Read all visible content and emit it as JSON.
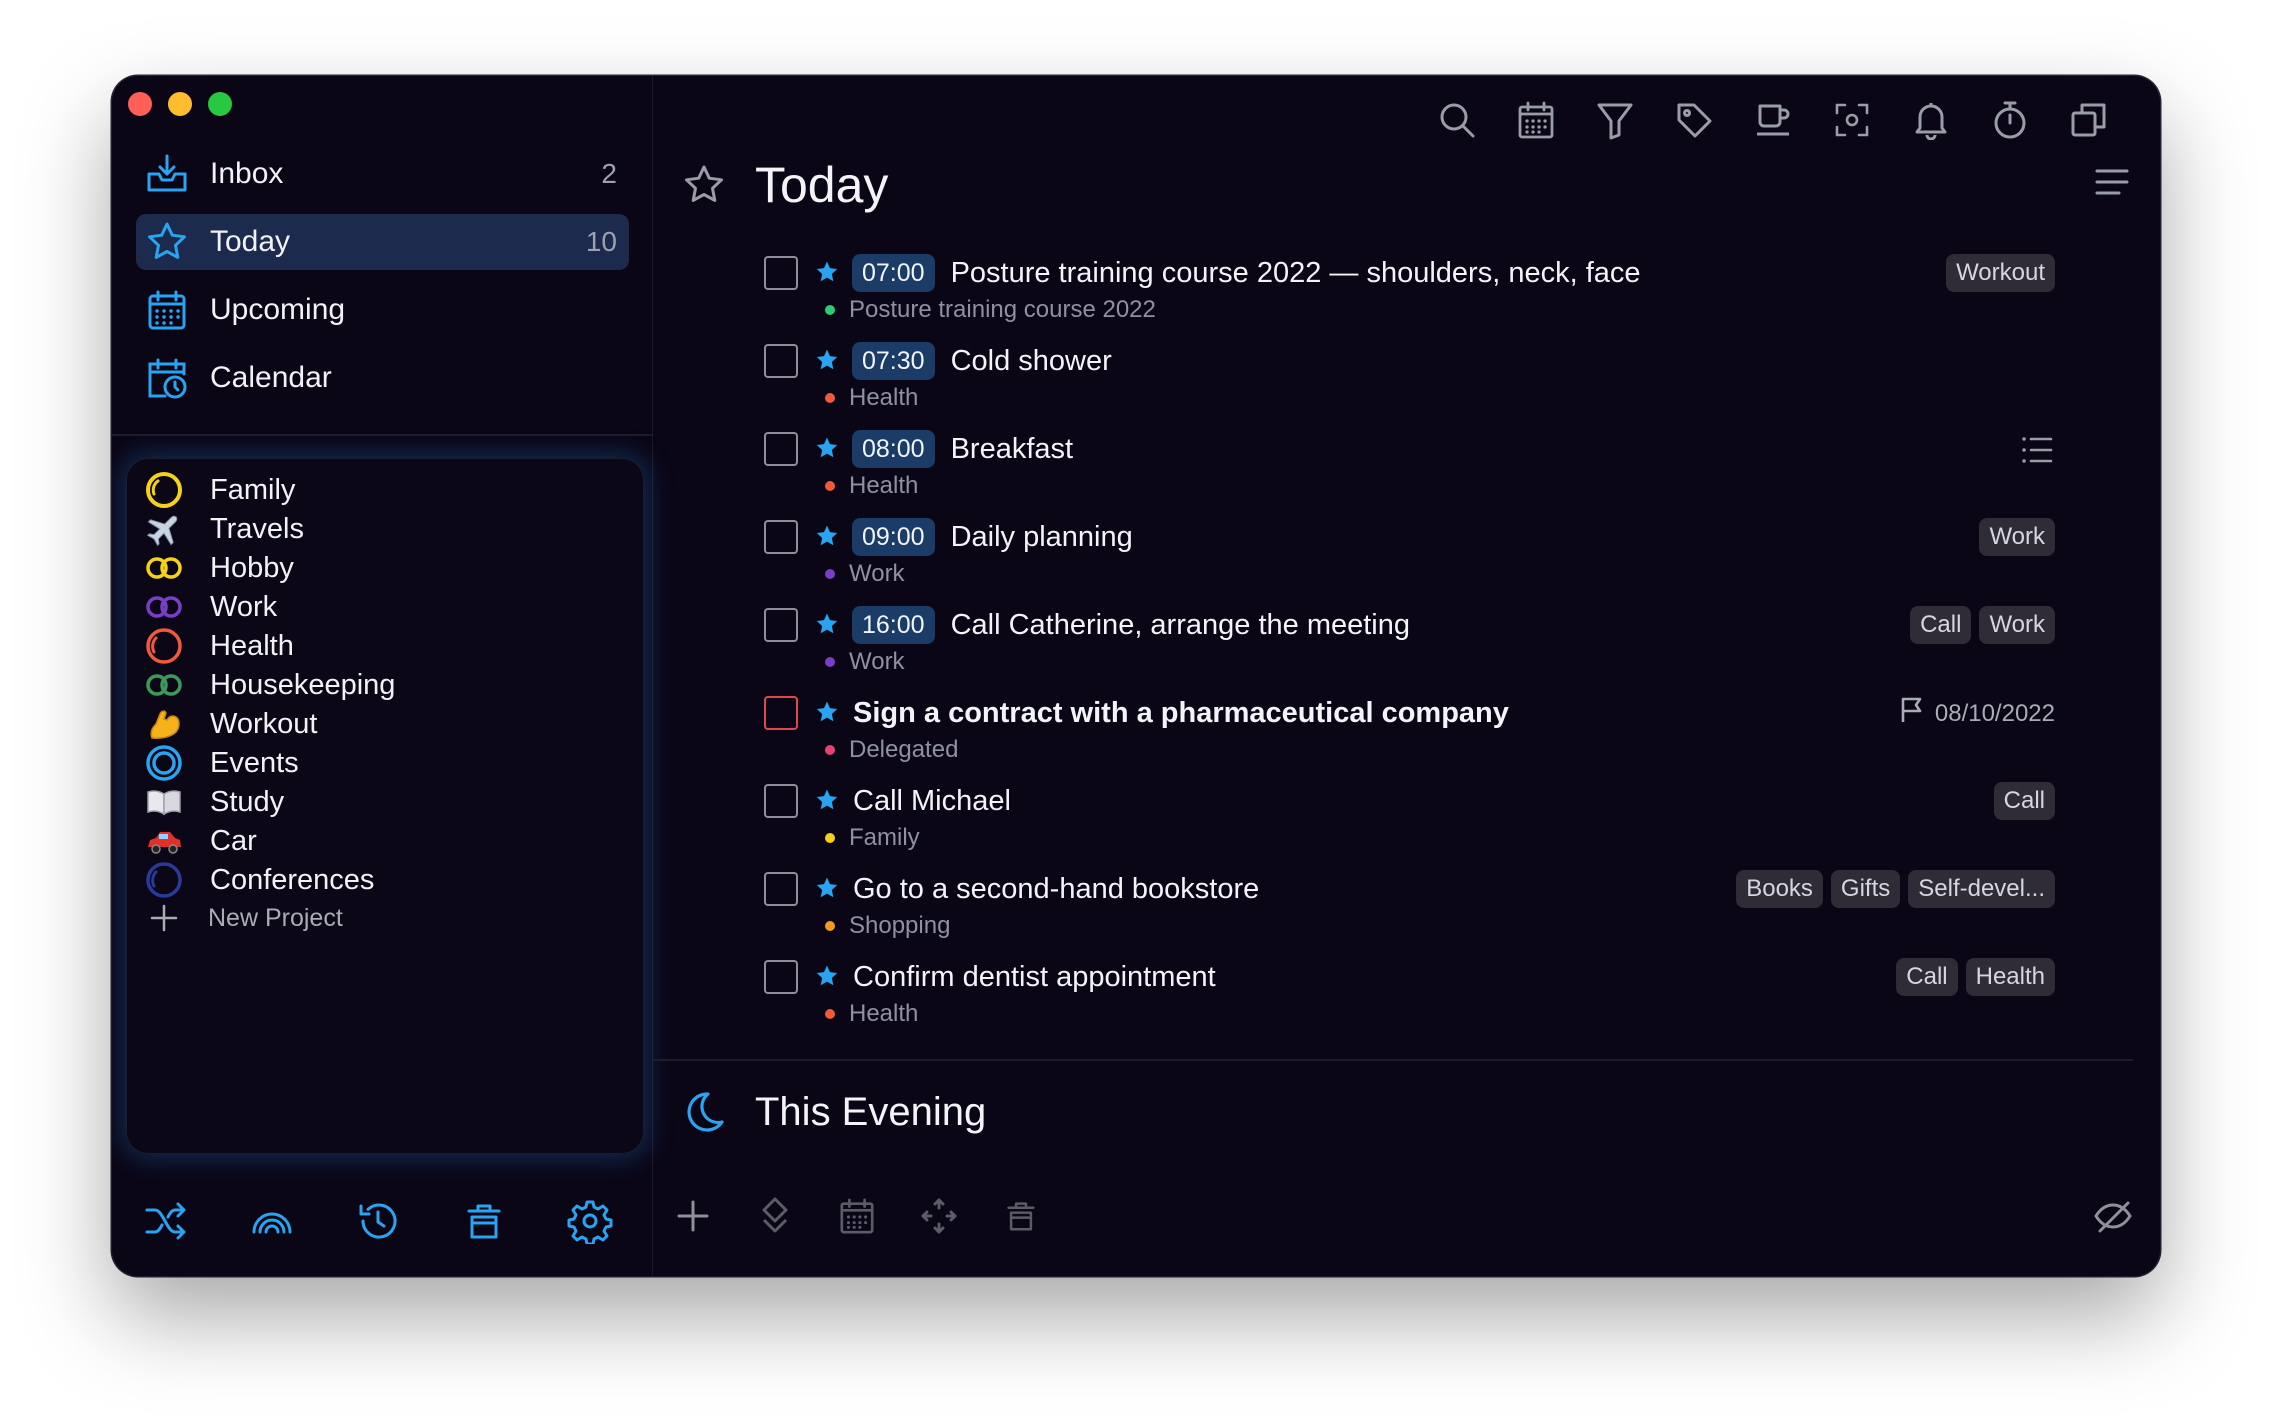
{
  "colors": {
    "accent": "#2aa3f0",
    "window_bg": "#0a0616",
    "active_nav": "#1b2a4d",
    "time_pill": "#1a3c66",
    "tag_bg": "#2f2c38",
    "overdue_checkbox": "#e1474f"
  },
  "sidebar": {
    "nav": [
      {
        "label": "Inbox",
        "count": "2",
        "icon": "inbox-icon",
        "active": false
      },
      {
        "label": "Today",
        "count": "10",
        "icon": "star-icon",
        "active": true
      },
      {
        "label": "Upcoming",
        "count": "",
        "icon": "calendar-grid-icon",
        "active": false
      },
      {
        "label": "Calendar",
        "count": "",
        "icon": "calendar-clock-icon",
        "active": false
      }
    ],
    "projects": [
      {
        "label": "Family",
        "icon": "yellow-circle-icon"
      },
      {
        "label": "Travels",
        "icon": "airplane-icon"
      },
      {
        "label": "Hobby",
        "icon": "yellow-infinity-icon"
      },
      {
        "label": "Work",
        "icon": "purple-infinity-icon"
      },
      {
        "label": "Health",
        "icon": "red-circle-icon"
      },
      {
        "label": "Housekeeping",
        "icon": "green-infinity-icon"
      },
      {
        "label": "Workout",
        "icon": "flexed-biceps-icon"
      },
      {
        "label": "Events",
        "icon": "blue-target-icon"
      },
      {
        "label": "Study",
        "icon": "open-book-icon"
      },
      {
        "label": "Car",
        "icon": "red-car-icon"
      },
      {
        "label": "Conferences",
        "icon": "navy-circle-icon"
      }
    ],
    "new_project_label": "New Project",
    "bottom_icons": [
      "shuffle-icon",
      "rainbow-icon",
      "history-icon",
      "trash-icon",
      "settings-gear-icon"
    ]
  },
  "toolbar": {
    "icons": [
      "search-icon",
      "calendar-icon",
      "filter-icon",
      "tag-icon",
      "cup-icon",
      "focus-icon",
      "bell-icon",
      "stopwatch-icon",
      "copy-windows-icon"
    ]
  },
  "main": {
    "title": "Today",
    "tasks": [
      {
        "time": "07:00",
        "title": "Posture training course 2022 — shoulders, neck, face",
        "project": "Posture training course 2022",
        "dot": "#2ecc71",
        "tags": [
          "Workout"
        ],
        "bold": false,
        "overdue": false,
        "due": "",
        "has_subtasks": false
      },
      {
        "time": "07:30",
        "title": "Cold shower",
        "project": "Health",
        "dot": "#f05a3a",
        "tags": [],
        "bold": false,
        "overdue": false,
        "due": "",
        "has_subtasks": false
      },
      {
        "time": "08:00",
        "title": "Breakfast",
        "project": "Health",
        "dot": "#f05a3a",
        "tags": [],
        "bold": false,
        "overdue": false,
        "due": "",
        "has_subtasks": true
      },
      {
        "time": "09:00",
        "title": "Daily planning",
        "project": "Work",
        "dot": "#7a3ec8",
        "tags": [
          "Work"
        ],
        "bold": false,
        "overdue": false,
        "due": "",
        "has_subtasks": false
      },
      {
        "time": "16:00",
        "title": "Call Catherine, arrange the meeting",
        "project": "Work",
        "dot": "#7a3ec8",
        "tags": [
          "Call",
          "Work"
        ],
        "bold": false,
        "overdue": false,
        "due": "",
        "has_subtasks": false
      },
      {
        "time": "",
        "title": "Sign a contract with a pharmaceutical company",
        "project": "Delegated",
        "dot": "#e84070",
        "tags": [],
        "bold": true,
        "overdue": true,
        "due": "08/10/2022",
        "has_subtasks": false
      },
      {
        "time": "",
        "title": "Call Michael",
        "project": "Family",
        "dot": "#f5d21a",
        "tags": [
          "Call"
        ],
        "bold": false,
        "overdue": false,
        "due": "",
        "has_subtasks": false
      },
      {
        "time": "",
        "title": "Go to a second-hand bookstore",
        "project": "Shopping",
        "dot": "#f59a1a",
        "tags": [
          "Books",
          "Gifts",
          "Self-devel..."
        ],
        "bold": false,
        "overdue": false,
        "due": "",
        "has_subtasks": false
      },
      {
        "time": "",
        "title": "Confirm dentist appointment",
        "project": "Health",
        "dot": "#f05a3a",
        "tags": [
          "Call",
          "Health"
        ],
        "bold": false,
        "overdue": false,
        "due": "",
        "has_subtasks": false
      }
    ],
    "evening_title": "This Evening",
    "bottom_icons": [
      "add-icon",
      "priority-icon",
      "calendar-icon",
      "move-icon",
      "trash-icon",
      "hide-completed-icon"
    ]
  }
}
